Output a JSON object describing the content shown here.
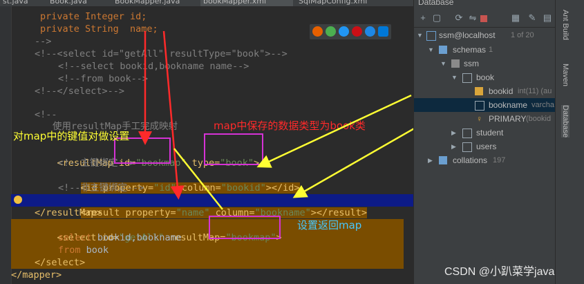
{
  "tabs": [
    "st.java",
    "Book.java",
    "BookMapper.java",
    "bookMapper.xml",
    "SqlMapConfig.xml"
  ],
  "code": {
    "l1": "private Integer id;",
    "l2": "private String  name;",
    "l3": "-->",
    "l4a": "<!--<select id=\"getAll\" resultType=\"book\">-->",
    "l5": "<!--select bookid,bookname name-->",
    "l6": "<!--from book-->",
    "l7": "<!--</select>-->",
    "l8": "<!--",
    "l9": "使用resultMap手工完成映射",
    "l10a": "<resultMap id=",
    "l10b": "\"bookmap\"",
    "l10c": " type=",
    "l10d": "\"book\"",
    "l10e": ">",
    "l11": "<!--主键绑定-->",
    "l12a": "<id property=",
    "l12b": "\"id\"",
    "l12c": " column=",
    "l12d": "\"bookid\"",
    "l12e": "></id>",
    "l13": "<!--非主键绑定-->",
    "l14a": "<result property=",
    "l14b": "\"name\"",
    "l14c": " column=",
    "l14d": "\"bookname\"",
    "l14e": "></result>",
    "l15": "</resultMap>",
    "l16a": "<select id=",
    "l16b": "\"getAll\"",
    "l16c": " resultMap=",
    "l16d": "\"bookmap\"",
    "l16e": ">",
    "l17a": "select",
    "l17b": " bookid,bookname",
    "l18a": "from",
    "l18b": " book",
    "l19": "</select>",
    "l20": "</mapper>"
  },
  "annotations": {
    "map_key": "对map中的键值对做设置",
    "map_type": "map中保存的数据类型为book类",
    "return_map": "设置返回map"
  },
  "database": {
    "title": "Database",
    "tree": {
      "conn": "ssm@localhost",
      "conn_count": "1 of 20",
      "schemas": "schemas",
      "schemas_count": "1",
      "ssm": "ssm",
      "book": "book",
      "bookid": "bookid",
      "bookid_type": "int(11) (au",
      "bookname": "bookname",
      "bookname_type": "varcha",
      "primary": "PRIMARY",
      "primary_type": "(bookid",
      "student": "student",
      "users": "users",
      "collations": "collations",
      "collations_count": "197"
    }
  },
  "side_tabs": [
    "Ant Build",
    "Maven",
    "Database"
  ],
  "watermark": "CSDN @小趴菜学java",
  "colors": {
    "highlight": "#7a4d00",
    "current_line": "#0d1b87",
    "box": "#d632d6",
    "arrow_red": "#ff2a2a",
    "arrow_yellow": "#ffff33"
  }
}
